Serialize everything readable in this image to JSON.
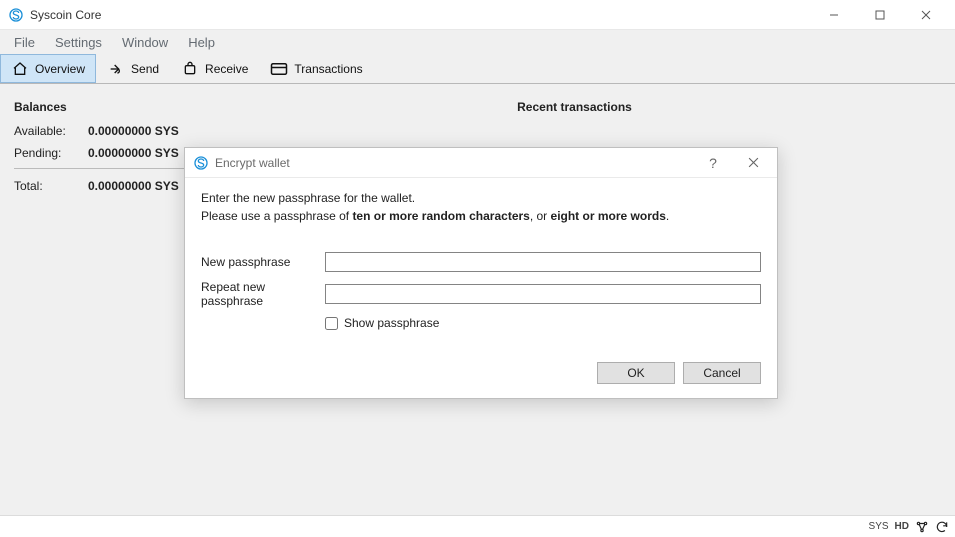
{
  "window": {
    "title": "Syscoin Core"
  },
  "menu": {
    "items": [
      "File",
      "Settings",
      "Window",
      "Help"
    ]
  },
  "toolbar": {
    "tabs": [
      {
        "label": "Overview",
        "active": true
      },
      {
        "label": "Send",
        "active": false
      },
      {
        "label": "Receive",
        "active": false
      },
      {
        "label": "Transactions",
        "active": false
      }
    ]
  },
  "balances": {
    "heading": "Balances",
    "rows": [
      {
        "label": "Available:",
        "value": "0.00000000 SYS"
      },
      {
        "label": "Pending:",
        "value": "0.00000000 SYS"
      }
    ],
    "total_label": "Total:",
    "total_value": "0.00000000 SYS"
  },
  "recent": {
    "heading": "Recent transactions"
  },
  "dialog": {
    "title": "Encrypt wallet",
    "instruction_line1": "Enter the new passphrase for the wallet.",
    "instruction_prefix": "Please use a passphrase of ",
    "instruction_bold1": "ten or more random characters",
    "instruction_mid": ", or ",
    "instruction_bold2": "eight or more words",
    "instruction_suffix": ".",
    "new_label": "New passphrase",
    "repeat_label": "Repeat new passphrase",
    "show_label": "Show passphrase",
    "ok": "OK",
    "cancel": "Cancel",
    "help_symbol": "?"
  },
  "statusbar": {
    "ticker": "SYS",
    "hd": "HD"
  }
}
